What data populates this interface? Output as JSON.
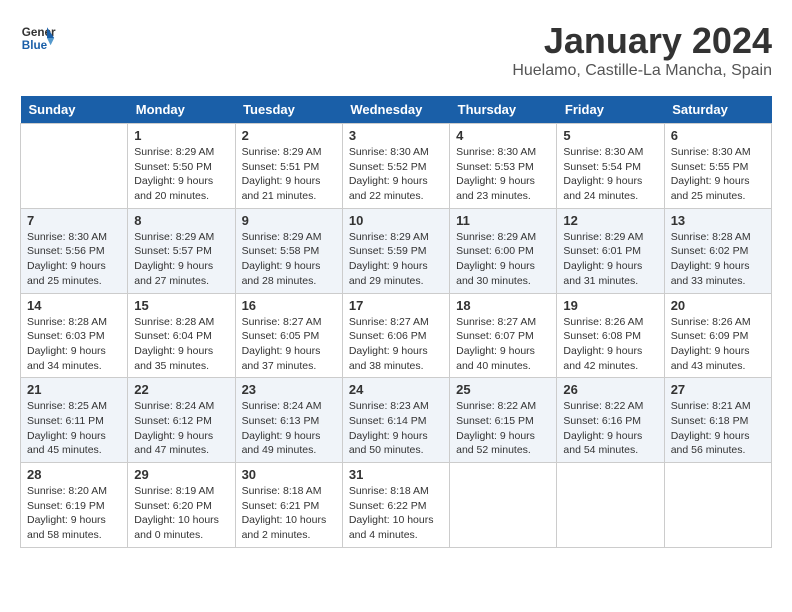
{
  "header": {
    "logo_line1": "General",
    "logo_line2": "Blue",
    "month": "January 2024",
    "location": "Huelamo, Castille-La Mancha, Spain"
  },
  "days": [
    "Sunday",
    "Monday",
    "Tuesday",
    "Wednesday",
    "Thursday",
    "Friday",
    "Saturday"
  ],
  "weeks": [
    [
      {
        "date": "",
        "sunrise": "",
        "sunset": "",
        "daylight": ""
      },
      {
        "date": "1",
        "sunrise": "Sunrise: 8:29 AM",
        "sunset": "Sunset: 5:50 PM",
        "daylight": "Daylight: 9 hours and 20 minutes."
      },
      {
        "date": "2",
        "sunrise": "Sunrise: 8:29 AM",
        "sunset": "Sunset: 5:51 PM",
        "daylight": "Daylight: 9 hours and 21 minutes."
      },
      {
        "date": "3",
        "sunrise": "Sunrise: 8:30 AM",
        "sunset": "Sunset: 5:52 PM",
        "daylight": "Daylight: 9 hours and 22 minutes."
      },
      {
        "date": "4",
        "sunrise": "Sunrise: 8:30 AM",
        "sunset": "Sunset: 5:53 PM",
        "daylight": "Daylight: 9 hours and 23 minutes."
      },
      {
        "date": "5",
        "sunrise": "Sunrise: 8:30 AM",
        "sunset": "Sunset: 5:54 PM",
        "daylight": "Daylight: 9 hours and 24 minutes."
      },
      {
        "date": "6",
        "sunrise": "Sunrise: 8:30 AM",
        "sunset": "Sunset: 5:55 PM",
        "daylight": "Daylight: 9 hours and 25 minutes."
      }
    ],
    [
      {
        "date": "7",
        "sunrise": "Sunrise: 8:30 AM",
        "sunset": "Sunset: 5:56 PM",
        "daylight": "Daylight: 9 hours and 25 minutes."
      },
      {
        "date": "8",
        "sunrise": "Sunrise: 8:29 AM",
        "sunset": "Sunset: 5:57 PM",
        "daylight": "Daylight: 9 hours and 27 minutes."
      },
      {
        "date": "9",
        "sunrise": "Sunrise: 8:29 AM",
        "sunset": "Sunset: 5:58 PM",
        "daylight": "Daylight: 9 hours and 28 minutes."
      },
      {
        "date": "10",
        "sunrise": "Sunrise: 8:29 AM",
        "sunset": "Sunset: 5:59 PM",
        "daylight": "Daylight: 9 hours and 29 minutes."
      },
      {
        "date": "11",
        "sunrise": "Sunrise: 8:29 AM",
        "sunset": "Sunset: 6:00 PM",
        "daylight": "Daylight: 9 hours and 30 minutes."
      },
      {
        "date": "12",
        "sunrise": "Sunrise: 8:29 AM",
        "sunset": "Sunset: 6:01 PM",
        "daylight": "Daylight: 9 hours and 31 minutes."
      },
      {
        "date": "13",
        "sunrise": "Sunrise: 8:28 AM",
        "sunset": "Sunset: 6:02 PM",
        "daylight": "Daylight: 9 hours and 33 minutes."
      }
    ],
    [
      {
        "date": "14",
        "sunrise": "Sunrise: 8:28 AM",
        "sunset": "Sunset: 6:03 PM",
        "daylight": "Daylight: 9 hours and 34 minutes."
      },
      {
        "date": "15",
        "sunrise": "Sunrise: 8:28 AM",
        "sunset": "Sunset: 6:04 PM",
        "daylight": "Daylight: 9 hours and 35 minutes."
      },
      {
        "date": "16",
        "sunrise": "Sunrise: 8:27 AM",
        "sunset": "Sunset: 6:05 PM",
        "daylight": "Daylight: 9 hours and 37 minutes."
      },
      {
        "date": "17",
        "sunrise": "Sunrise: 8:27 AM",
        "sunset": "Sunset: 6:06 PM",
        "daylight": "Daylight: 9 hours and 38 minutes."
      },
      {
        "date": "18",
        "sunrise": "Sunrise: 8:27 AM",
        "sunset": "Sunset: 6:07 PM",
        "daylight": "Daylight: 9 hours and 40 minutes."
      },
      {
        "date": "19",
        "sunrise": "Sunrise: 8:26 AM",
        "sunset": "Sunset: 6:08 PM",
        "daylight": "Daylight: 9 hours and 42 minutes."
      },
      {
        "date": "20",
        "sunrise": "Sunrise: 8:26 AM",
        "sunset": "Sunset: 6:09 PM",
        "daylight": "Daylight: 9 hours and 43 minutes."
      }
    ],
    [
      {
        "date": "21",
        "sunrise": "Sunrise: 8:25 AM",
        "sunset": "Sunset: 6:11 PM",
        "daylight": "Daylight: 9 hours and 45 minutes."
      },
      {
        "date": "22",
        "sunrise": "Sunrise: 8:24 AM",
        "sunset": "Sunset: 6:12 PM",
        "daylight": "Daylight: 9 hours and 47 minutes."
      },
      {
        "date": "23",
        "sunrise": "Sunrise: 8:24 AM",
        "sunset": "Sunset: 6:13 PM",
        "daylight": "Daylight: 9 hours and 49 minutes."
      },
      {
        "date": "24",
        "sunrise": "Sunrise: 8:23 AM",
        "sunset": "Sunset: 6:14 PM",
        "daylight": "Daylight: 9 hours and 50 minutes."
      },
      {
        "date": "25",
        "sunrise": "Sunrise: 8:22 AM",
        "sunset": "Sunset: 6:15 PM",
        "daylight": "Daylight: 9 hours and 52 minutes."
      },
      {
        "date": "26",
        "sunrise": "Sunrise: 8:22 AM",
        "sunset": "Sunset: 6:16 PM",
        "daylight": "Daylight: 9 hours and 54 minutes."
      },
      {
        "date": "27",
        "sunrise": "Sunrise: 8:21 AM",
        "sunset": "Sunset: 6:18 PM",
        "daylight": "Daylight: 9 hours and 56 minutes."
      }
    ],
    [
      {
        "date": "28",
        "sunrise": "Sunrise: 8:20 AM",
        "sunset": "Sunset: 6:19 PM",
        "daylight": "Daylight: 9 hours and 58 minutes."
      },
      {
        "date": "29",
        "sunrise": "Sunrise: 8:19 AM",
        "sunset": "Sunset: 6:20 PM",
        "daylight": "Daylight: 10 hours and 0 minutes."
      },
      {
        "date": "30",
        "sunrise": "Sunrise: 8:18 AM",
        "sunset": "Sunset: 6:21 PM",
        "daylight": "Daylight: 10 hours and 2 minutes."
      },
      {
        "date": "31",
        "sunrise": "Sunrise: 8:18 AM",
        "sunset": "Sunset: 6:22 PM",
        "daylight": "Daylight: 10 hours and 4 minutes."
      },
      {
        "date": "",
        "sunrise": "",
        "sunset": "",
        "daylight": ""
      },
      {
        "date": "",
        "sunrise": "",
        "sunset": "",
        "daylight": ""
      },
      {
        "date": "",
        "sunrise": "",
        "sunset": "",
        "daylight": ""
      }
    ]
  ]
}
